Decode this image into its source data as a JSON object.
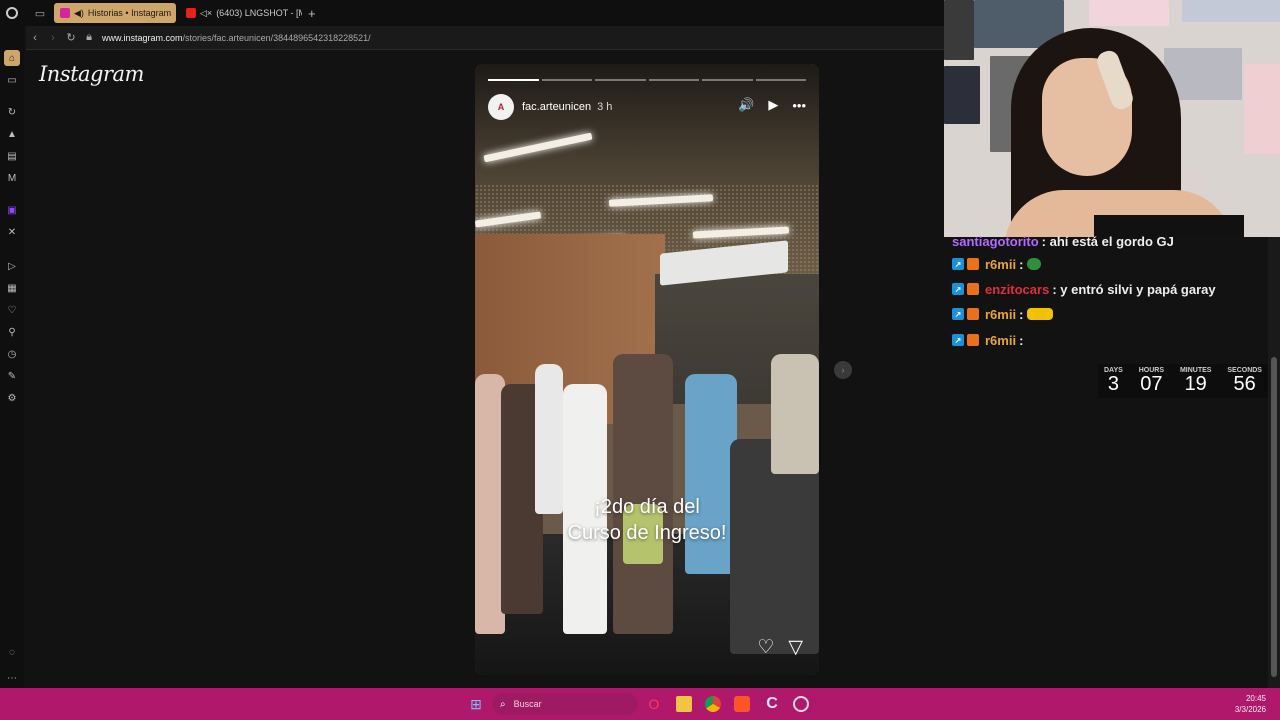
{
  "tabs": [
    {
      "label": "Historias • Instagram",
      "active": true
    },
    {
      "label": "(6403) LNGSHOT - [M",
      "active": false
    }
  ],
  "address": {
    "host": "www.instagram.com",
    "path": "/stories/fac.arteunicen/3844896542318228521/"
  },
  "logo": "Instagram",
  "story": {
    "avatar_letter": "A",
    "account": "fac.arteunicen",
    "time": "3 h",
    "caption_line1": "¡2do día del",
    "caption_line2": "Curso de Ingreso!",
    "segments_total": 6,
    "segments_done": 1
  },
  "icons": {
    "volume": "🔊",
    "play": "▶",
    "more": "•••",
    "like": "♡",
    "share": "▽",
    "next": "›"
  },
  "chat": [
    {
      "user": "santiagotorito",
      "user_color": "#b36bff",
      "message": ": ahí está el gordo GJ",
      "badges": false,
      "emote": ""
    },
    {
      "user": "r6mii",
      "user_color": "#e8a33a",
      "message": " :",
      "badges": true,
      "emote": "green"
    },
    {
      "user": "enzitocars",
      "user_color": "#e0303a",
      "message": ": y entró silvi y papá garay",
      "badges": true,
      "emote": ""
    },
    {
      "user": "r6mii",
      "user_color": "#e8a33a",
      "message": " :",
      "badges": true,
      "emote": "taxi"
    },
    {
      "user": "r6mii",
      "user_color": "#e8a33a",
      "message": " :",
      "badges": true,
      "emote": ""
    }
  ],
  "countdown": {
    "days_label": "DAYS",
    "days": "3",
    "hours_label": "HOURS",
    "hours": "07",
    "minutes_label": "MINUTES",
    "minutes": "19",
    "seconds_label": "SECONDS",
    "seconds": "56"
  },
  "taskbar": {
    "search_placeholder": "Buscar",
    "time": "20:45",
    "date": "3/3/2026"
  }
}
